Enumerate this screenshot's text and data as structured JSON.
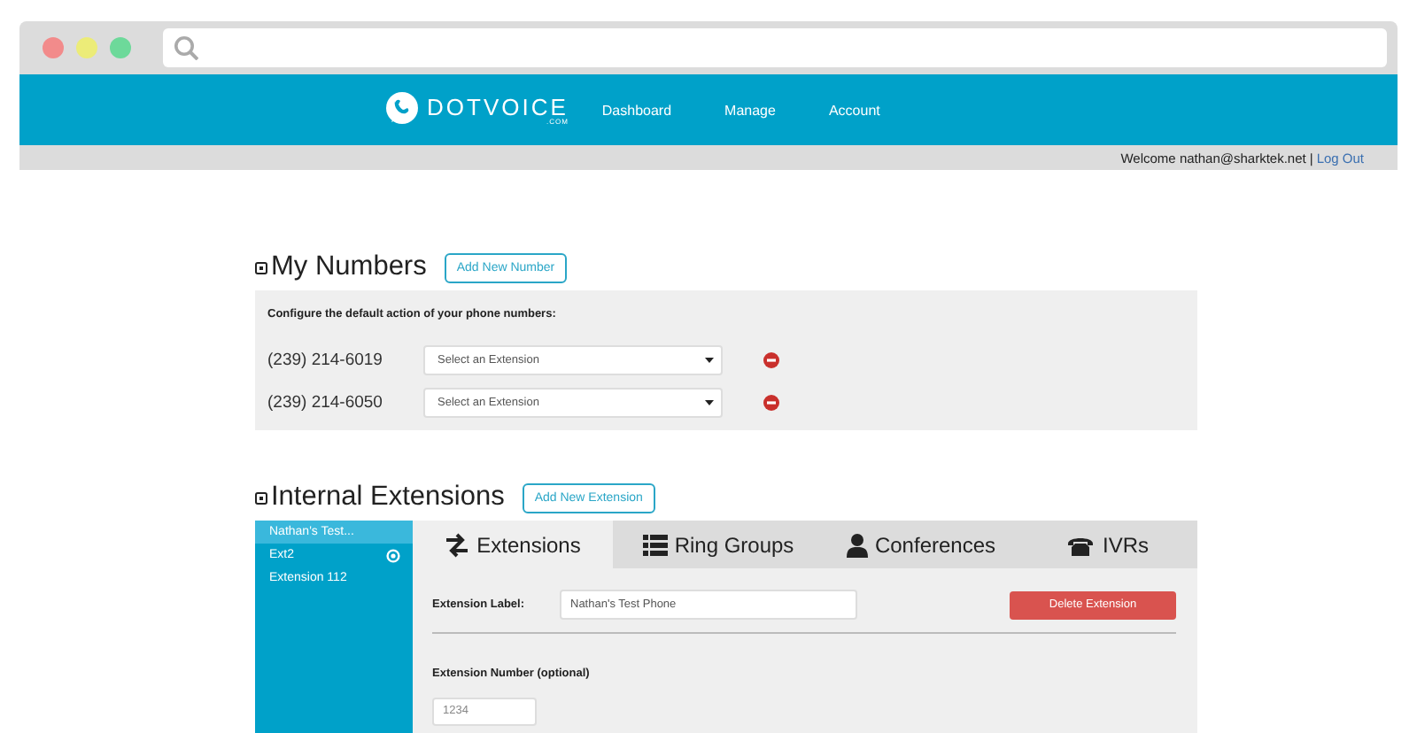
{
  "header": {
    "logo": {
      "name": "DOTVOICE",
      "sub": ".COM"
    },
    "nav": [
      {
        "label": "Dashboard"
      },
      {
        "label": "Manage"
      },
      {
        "label": "Account"
      }
    ]
  },
  "user_bar": {
    "welcome": "Welcome nathan@sharktek.net",
    "separator": "|",
    "logout": "Log Out"
  },
  "my_numbers": {
    "title": "My Numbers",
    "add_button": "Add New Number",
    "instruction": "Configure the default action of your phone numbers:",
    "numbers": [
      {
        "number": "(239) 214-6019",
        "select": "Select an Extension"
      },
      {
        "number": "(239) 214-6050",
        "select": "Select an Extension"
      }
    ]
  },
  "internal_extensions": {
    "title": "Internal Extensions",
    "add_button": "Add New Extension",
    "sidebar": [
      {
        "label": "Nathan's Test...",
        "selected": true,
        "kind": "plain"
      },
      {
        "label": "Ext2",
        "selected": false,
        "kind": "badge"
      },
      {
        "label": "Extension 112",
        "selected": false,
        "kind": "plain"
      }
    ],
    "tabs": [
      {
        "label": "Extensions",
        "kind": "arrows",
        "selected": true
      },
      {
        "label": "Ring Groups",
        "kind": "list",
        "selected": false
      },
      {
        "label": "Conferences",
        "kind": "user",
        "selected": false
      },
      {
        "label": "IVRs",
        "kind": "phone",
        "selected": false
      }
    ],
    "form": {
      "label_field": {
        "label": "Extension Label:",
        "value": "Nathan's Test Phone"
      },
      "delete_button": "Delete Extension",
      "number_field": {
        "label": "Extension Number (optional)",
        "placeholder": "1234"
      }
    }
  }
}
